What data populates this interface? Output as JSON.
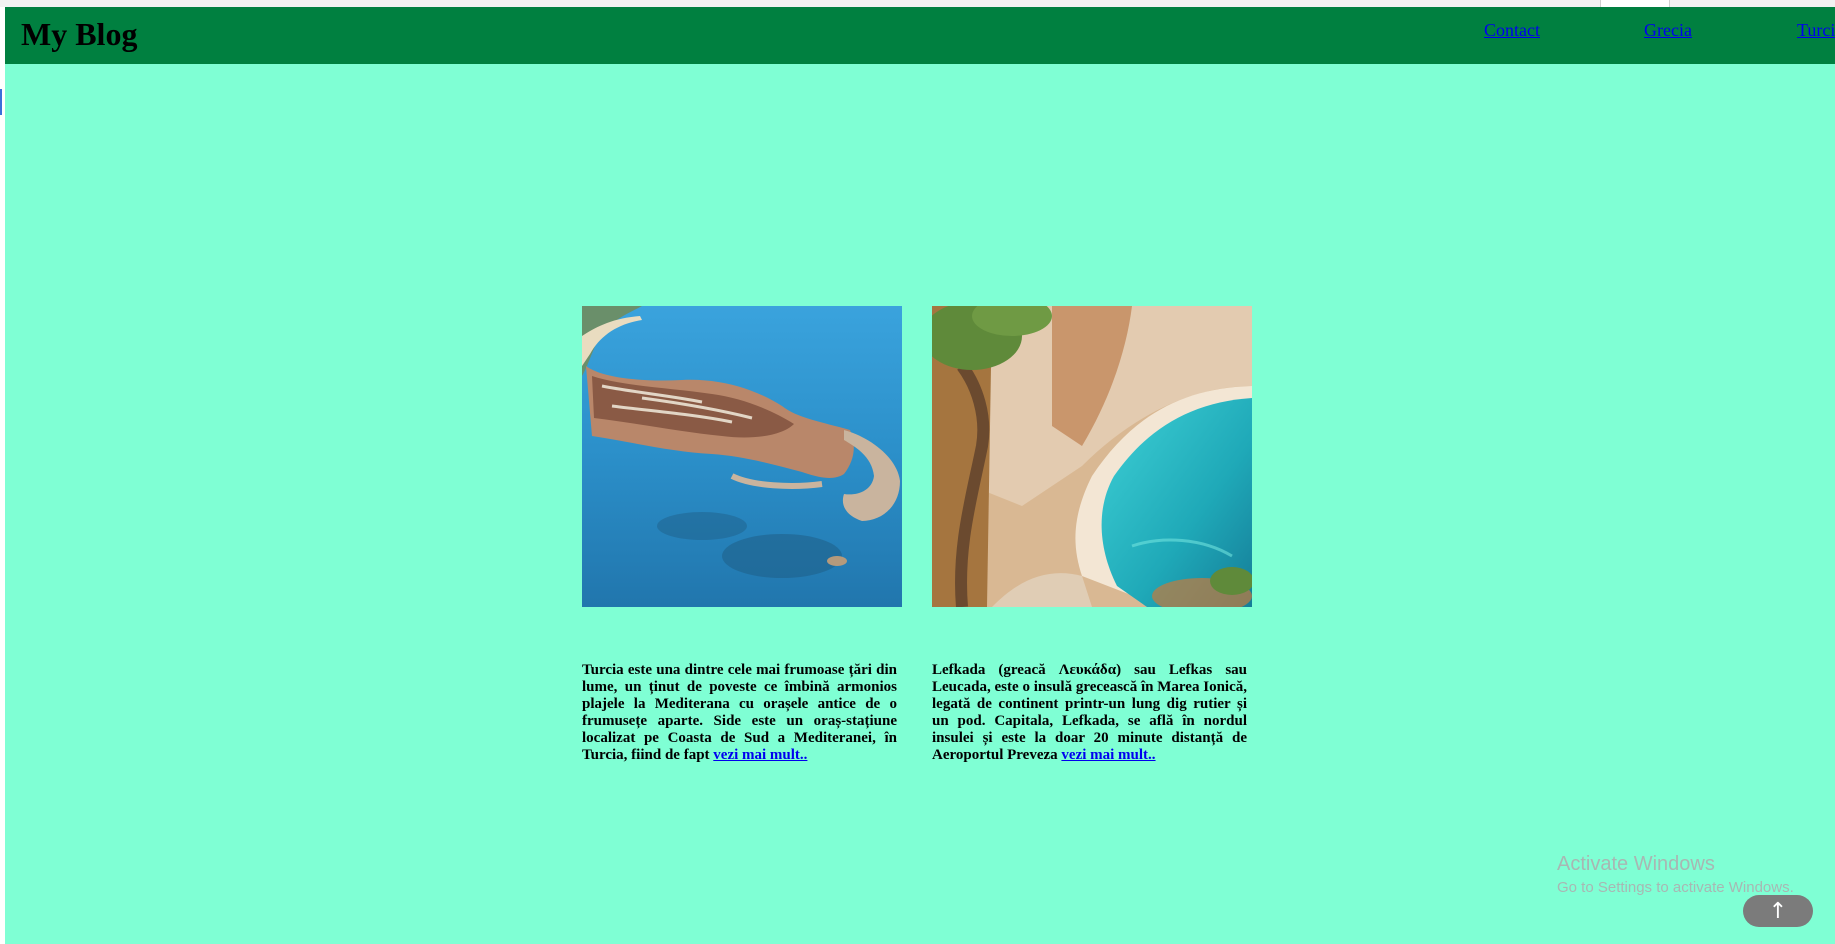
{
  "header": {
    "brand": "My Blog",
    "nav": [
      {
        "label": "Contact"
      },
      {
        "label": "Grecia"
      },
      {
        "label": "Turcia"
      }
    ]
  },
  "cards": [
    {
      "image_alt": "Aerial view of Side peninsula, Turkey",
      "text": "Turcia este una dintre cele mai frumoase țări din lume, un ținut de poveste ce îmbină armonios plajele la Mediterana cu orașele antice de o frumusețe aparte. Side este un oraș-stațiune localizat pe Coasta de Sud a Mediteranei, în Turcia, fiind de fapt ",
      "link": "vezi mai mult.."
    },
    {
      "image_alt": "Beach and cliffs in Lefkada, Greece",
      "text": "Lefkada (greacă Λευκάδα) sau Lefkas sau Leucada, este o insulă grecească în Marea Ionică, legată de continent printr-un lung dig rutier și un pod. Capitala, Lefkada, se află în nordul insulei și este la doar 20 minute distanță de Aeroportul Preveza ",
      "link": "vezi mai mult.."
    }
  ],
  "watermark": {
    "line1": "Activate Windows",
    "line2": "Go to Settings to activate Windows."
  },
  "scroll_top": {
    "icon": "arrow-up-icon",
    "glyph": "↑"
  },
  "colors": {
    "page_bg": "#7fffd4",
    "navbar_bg": "#008040",
    "link": "#0000ee"
  }
}
